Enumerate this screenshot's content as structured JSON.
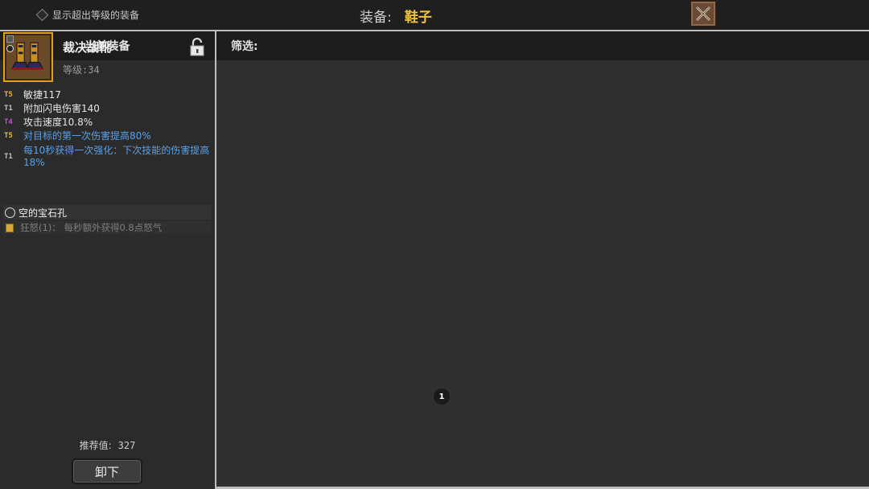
{
  "topbar": {
    "show_over_level_label": "显示超出等级的装备",
    "equip_key": "装备:",
    "equip_value": "鞋子"
  },
  "left": {
    "header": "当前装备",
    "item_name": "裁决战靴",
    "item_level": "等级:34",
    "stats": [
      {
        "tier": "T5",
        "text": "敏捷117"
      },
      {
        "tier": "T1",
        "text": "附加闪电伤害140"
      },
      {
        "tier": "T4",
        "text": "攻击速度10.8%"
      },
      {
        "tier": "T5",
        "text": "对目标的第一次伤害提高80%"
      },
      {
        "tier": "T1",
        "text": "每10秒获得一次强化：下次技能的伤害提高18%"
      }
    ],
    "gem_slot": "空的宝石孔",
    "rage": "狂怒(1)：  每秒额外获得0.8点怒气",
    "recommend_label": "推荐值:",
    "recommend_value": "327",
    "unequip": "卸下"
  },
  "filter": {
    "label": "筛选:"
  },
  "pagination": {
    "current": "1"
  },
  "colors": {
    "accent_gold": "#f2c23a",
    "tier5": "#f0b830",
    "tier4": "#c34bd6",
    "tier1": "#c0c0c0",
    "affix_blue": "#5aa0e6"
  }
}
